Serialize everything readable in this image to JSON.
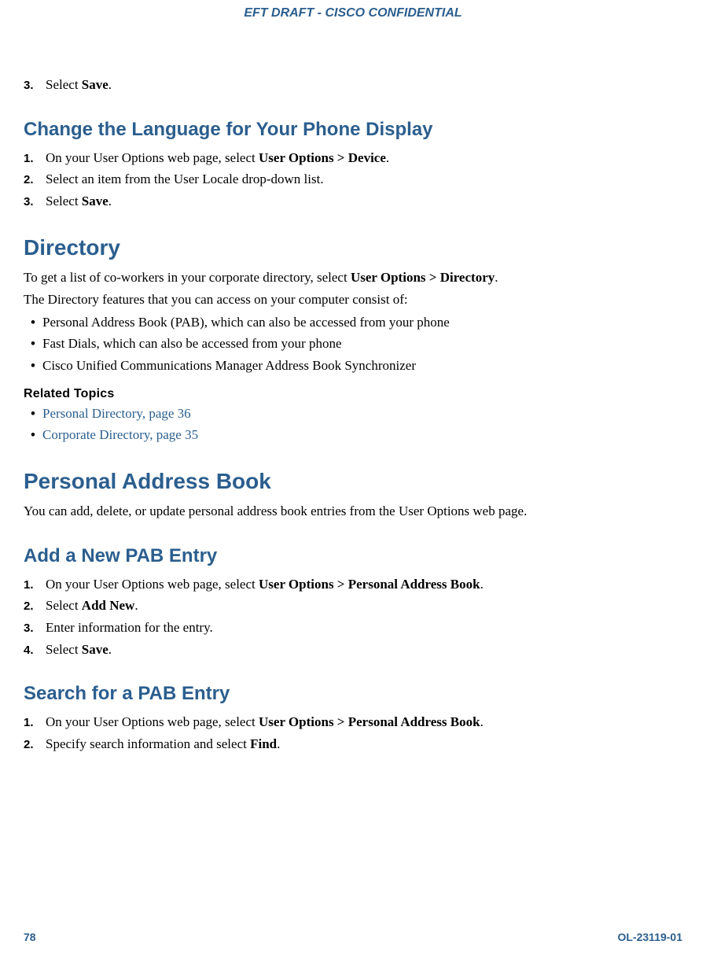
{
  "header": {
    "draft_label": "EFT DRAFT - CISCO CONFIDENTIAL"
  },
  "step3_prefix": "Select ",
  "step3_bold": "Save",
  "step3_suffix": ".",
  "section_change": {
    "title": "Change the Language for Your Phone Display",
    "steps": [
      {
        "n": "1.",
        "prefix": "On your User Options web page, select ",
        "bold": "User Options > Device",
        "suffix": "."
      },
      {
        "n": "2.",
        "prefix": "Select an item from the User Locale drop-down list.",
        "bold": "",
        "suffix": ""
      },
      {
        "n": "3.",
        "prefix": "Select ",
        "bold": "Save",
        "suffix": "."
      }
    ]
  },
  "section_directory": {
    "title": "Directory",
    "para1_prefix": "To get a list of co-workers in your corporate directory, select ",
    "para1_bold": "User Options > Directory",
    "para1_suffix": ".",
    "para2": "The Directory features that you can access on your computer consist of:",
    "bullets": [
      "Personal Address Book (PAB), which can also be accessed from your phone",
      "Fast Dials, which can also be accessed from your phone",
      "Cisco Unified Communications Manager Address Book Synchronizer"
    ],
    "related_heading": "Related Topics",
    "related_links": [
      "Personal Directory, page 36",
      "Corporate Directory, page 35"
    ]
  },
  "section_pab": {
    "title": "Personal Address Book",
    "para": "You can add, delete, or update personal address book entries from the User Options web page."
  },
  "section_add": {
    "title": "Add a New PAB Entry",
    "steps": [
      {
        "n": "1.",
        "prefix": "On your User Options web page, select ",
        "bold": "User Options > Personal Address Book",
        "suffix": "."
      },
      {
        "n": "2.",
        "prefix": "Select ",
        "bold": "Add New",
        "suffix": "."
      },
      {
        "n": "3.",
        "prefix": "Enter information for the entry.",
        "bold": "",
        "suffix": ""
      },
      {
        "n": "4.",
        "prefix": "Select ",
        "bold": "Save",
        "suffix": "."
      }
    ]
  },
  "section_search": {
    "title": "Search for a PAB Entry",
    "steps": [
      {
        "n": "1.",
        "prefix": "On your User Options web page, select ",
        "bold": "User Options > Personal Address Book",
        "suffix": "."
      },
      {
        "n": "2.",
        "prefix": "Specify search information and select ",
        "bold": "Find",
        "suffix": "."
      }
    ]
  },
  "footer": {
    "page_number": "78",
    "doc_id": "OL-23119-01"
  }
}
